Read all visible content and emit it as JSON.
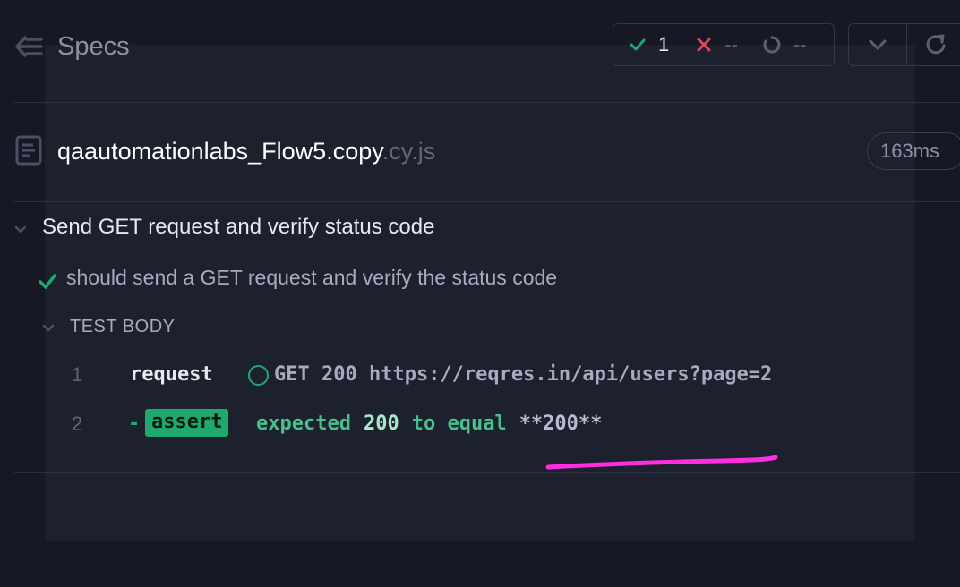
{
  "header": {
    "title": "Specs",
    "stats": {
      "passed": "1",
      "failed": "--",
      "pending": "--"
    }
  },
  "spec": {
    "file_name": "qaautomationlabs_Flow5.copy",
    "file_ext": ".cy.js",
    "duration": "163ms"
  },
  "suite": {
    "title": "Send GET request and verify status code",
    "test": {
      "title": "should send a GET request and verify the status code",
      "body_label": "TEST BODY",
      "commands": [
        {
          "number": "1",
          "name": "request",
          "message": "GET 200 https://reqres.in/api/users?page=2"
        },
        {
          "number": "2",
          "dash": "-",
          "name": "assert",
          "message_parts": [
            "expected",
            "200",
            "to equal",
            "**200**"
          ]
        }
      ]
    }
  },
  "colors": {
    "background": "#161823",
    "panel": "#1d202d",
    "pass": "#1fa971",
    "fail": "#e0475b",
    "annotation": "#ff2ee0"
  },
  "icons": [
    "back-arrow-icon",
    "check-icon",
    "x-icon",
    "pending-spinner-icon",
    "chevron-down-icon",
    "refresh-icon",
    "file-icon"
  ]
}
